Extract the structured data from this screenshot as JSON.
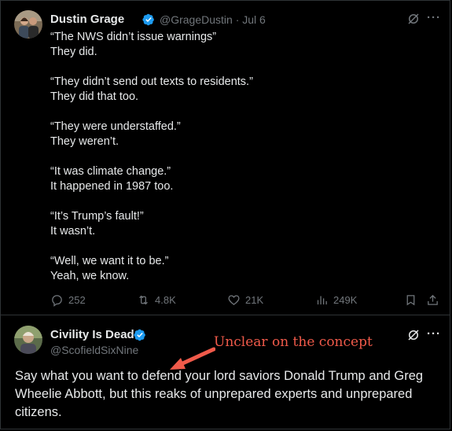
{
  "tweet": {
    "author_name": "Dustin Grage",
    "handle": "@GrageDustin",
    "separator": "·",
    "date": "Jul 6",
    "lines": [
      "“The NWS didn’t issue warnings”",
      "They did.",
      "",
      "“They didn’t send out texts to residents.”",
      "They did that too.",
      "",
      "“They were understaffed.”",
      "They weren’t.",
      "",
      "“It was climate change.”",
      "It happened in 1987 too.",
      "",
      "“It’s Trump’s fault!”",
      "It wasn’t.",
      "",
      "“Well, we want it to be.”",
      "Yeah, we know."
    ],
    "stats": {
      "replies": "252",
      "reposts": "4.8K",
      "likes": "21K",
      "views": "249K"
    }
  },
  "reply": {
    "author_name": "Civility Is Dead",
    "handle": "@ScofieldSixNine",
    "text": "Say what you want to defend your lord saviors Donald Trump and Greg Wheelie Abbott, but this reaks of unprepared experts and unprepared citizens."
  },
  "annotation": {
    "text": "Unclear on the concept",
    "color": "#f05a4a"
  },
  "colors": {
    "background": "#000000",
    "text": "#e7e9ea",
    "muted": "#71767b",
    "verified": "#1d9bf0",
    "divider": "#2f3336"
  },
  "icons": {
    "verified": "verified-badge-icon",
    "grok": "grok-icon",
    "more": "more-icon",
    "reply": "reply-icon",
    "repost": "repost-icon",
    "like": "like-icon",
    "views": "views-icon",
    "bookmark": "bookmark-icon",
    "share": "share-icon"
  }
}
